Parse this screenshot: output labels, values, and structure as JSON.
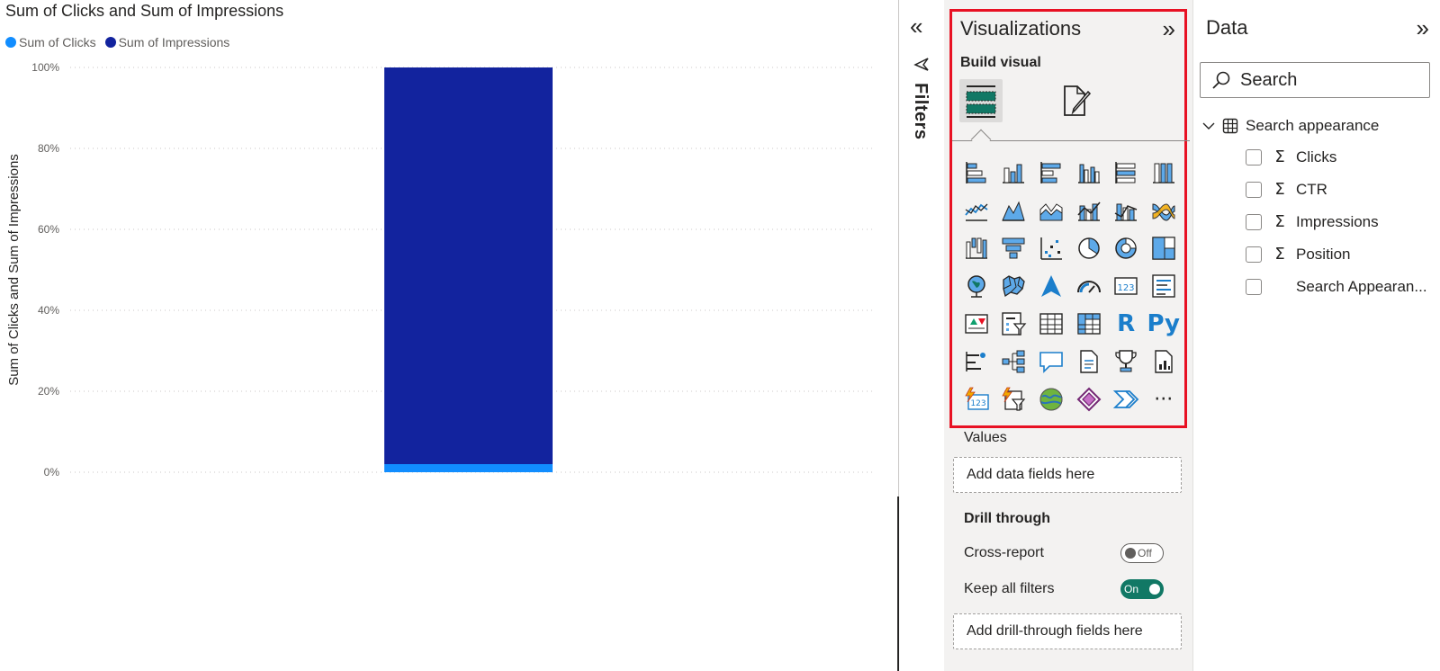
{
  "chart": {
    "title": "Sum of Clicks and Sum of Impressions",
    "legend": [
      {
        "label": "Sum of Clicks",
        "color": "#118dff"
      },
      {
        "label": "Sum of Impressions",
        "color": "#12239e"
      }
    ]
  },
  "chart_data": {
    "type": "bar",
    "stacked": "100%",
    "title": "Sum of Clicks and Sum of Impressions",
    "xlabel": "",
    "ylabel": "Sum of Clicks and Sum of Impressions",
    "y_ticks": [
      "0%",
      "20%",
      "40%",
      "60%",
      "80%",
      "100%"
    ],
    "ylim": [
      0,
      100
    ],
    "grid": true,
    "legend_position": "top-left",
    "categories": [
      ""
    ],
    "series": [
      {
        "name": "Sum of Clicks",
        "values": [
          2
        ],
        "color": "#118dff"
      },
      {
        "name": "Sum of Impressions",
        "values": [
          98
        ],
        "color": "#12239e"
      }
    ]
  },
  "filters": {
    "label": "Filters",
    "collapse_icon": "chevron-double-left-icon",
    "icon": "filter-icon"
  },
  "visualizations": {
    "title": "Visualizations",
    "build_label": "Build visual",
    "icons": [
      "stacked-bar-chart-icon",
      "stacked-column-chart-icon",
      "clustered-bar-chart-icon",
      "clustered-column-chart-icon",
      "100-stacked-bar-chart-icon",
      "100-stacked-column-chart-icon",
      "line-chart-icon",
      "area-chart-icon",
      "stacked-area-chart-icon",
      "line-and-stacked-column-icon",
      "line-and-clustered-column-icon",
      "ribbon-chart-icon",
      "waterfall-chart-icon",
      "funnel-icon",
      "scatter-chart-icon",
      "pie-chart-icon",
      "donut-chart-icon",
      "treemap-icon",
      "map-icon",
      "filled-map-icon",
      "azure-map-icon",
      "gauge-icon",
      "card-icon",
      "multi-row-card-icon",
      "kpi-icon",
      "slicer-icon",
      "table-icon",
      "matrix-icon",
      "r-visual-icon",
      "python-visual-icon",
      "key-influencers-icon",
      "decomposition-tree-icon",
      "qna-icon",
      "smart-narrative-icon",
      "metrics-icon",
      "paginated-report-icon",
      "power-automate-card-icon",
      "power-automate-slicer-icon",
      "arcgis-map-icon",
      "power-apps-icon",
      "power-automate-icon",
      "more-visuals-icon"
    ],
    "r_label": "R",
    "py_label": "Py",
    "more_label": "···",
    "values_label": "Values",
    "values_dropzone": "Add data fields here",
    "drill_label": "Drill through",
    "cross_report_label": "Cross-report",
    "cross_report_state": "Off",
    "keep_filters_label": "Keep all filters",
    "keep_filters_state": "On",
    "drill_dropzone": "Add drill-through fields here"
  },
  "data_pane": {
    "title": "Data",
    "search_placeholder": "Search",
    "table_name": "Search appearance",
    "fields": [
      {
        "name": "Clicks",
        "sigma": true
      },
      {
        "name": "CTR",
        "sigma": true
      },
      {
        "name": "Impressions",
        "sigma": true
      },
      {
        "name": "Position",
        "sigma": true
      },
      {
        "name": "Search Appearan...",
        "sigma": false
      }
    ]
  }
}
